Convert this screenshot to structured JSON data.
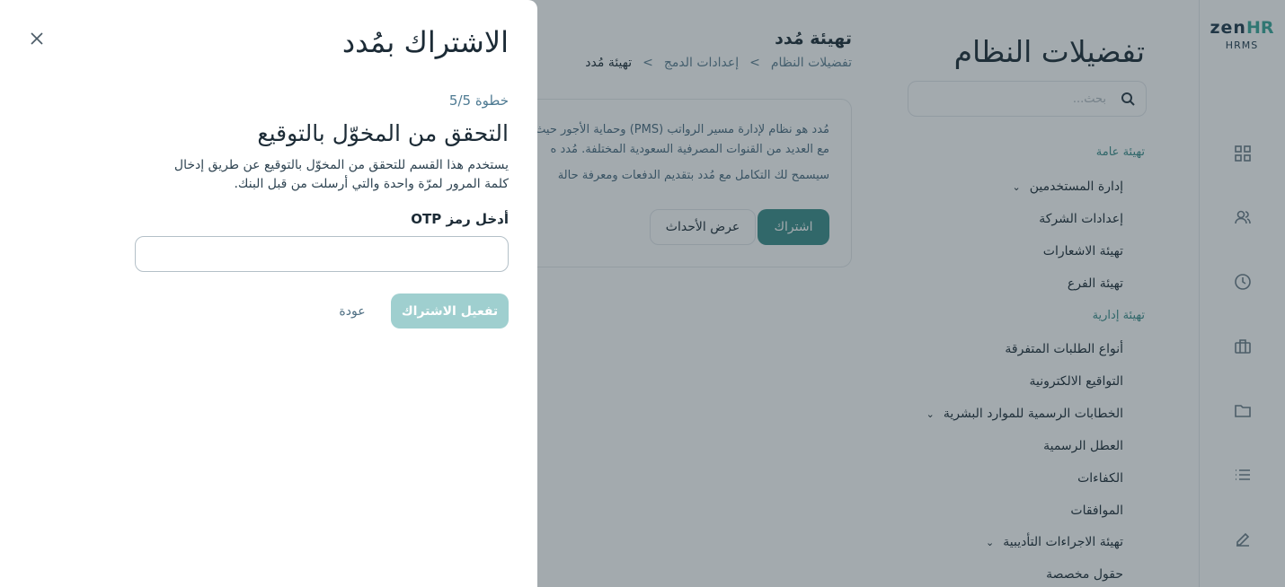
{
  "brand": {
    "logo_zen": "zen",
    "logo_hr": "HR",
    "logo_sub": "HRMS",
    "accent": "#3b8e8a"
  },
  "rail": {
    "icons": [
      "grid-icon",
      "users-icon",
      "clock-icon",
      "briefcase-icon",
      "folder-icon",
      "list-icon",
      "edit-icon"
    ]
  },
  "nav": {
    "title": "تفضيلات النظام",
    "search_placeholder": "بحث...",
    "section_general": "تهيئة عامة",
    "items_general": [
      "إدارة المستخدمين",
      "إعدادات الشركة",
      "تهيئة الاشعارات",
      "تهيئة الفرع"
    ],
    "section_admin": "تهيئة إدارية",
    "items_admin": [
      "أنواع الطلبات المتفرقة",
      "التواقيع الالكترونية",
      "الخطابات الرسمية للموارد البشرية",
      "العطل الرسمية",
      "الكفاءات",
      "الموافقات",
      "تهيئة الاجراءات التأديبية",
      "حقول مخصصة"
    ]
  },
  "main": {
    "title": "تهيئة مُدد",
    "breadcrumb": [
      "تفضيلات النظام",
      "إعدادات الدمج",
      "تهيئة مُدد"
    ],
    "breadcrumb_sep": ">",
    "card_line1": "مُدد هو نظام لإدارة مسير الرواتب (PMS) وحماية الأجور حيث",
    "card_line2": "مع العديد من القنوات المصرفية السعودية المختلفة. مُدد ه",
    "card_line3": "سيسمح لك التكامل مع مُدد بتقديم الدفعات ومعرفة حالة",
    "subscribe_label": "اشتراك",
    "events_label": "عرض الأحداث"
  },
  "drawer": {
    "title": "الاشتراك بمُدد",
    "step": "خطوة 5/5",
    "heading": "التحقق من المخوّل بالتوقيع",
    "description": "يستخدم هذا القسم للتحقق من المخوّل بالتوقيع عن طريق إدخال كلمة المرور لمرّة واحدة والتي أرسلت من قبل البنك.",
    "otp_label": "أدخل رمز OTP",
    "otp_value": "",
    "activate_label": "تفعيل الاشتراك",
    "back_label": "عودة"
  }
}
